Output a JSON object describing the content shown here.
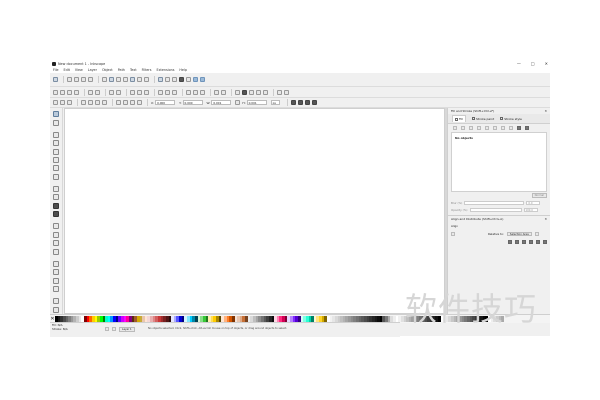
{
  "window": {
    "title": "New document 1 - Inkscape",
    "controls": [
      "—",
      "□",
      "✕"
    ]
  },
  "menu": [
    "File",
    "Edit",
    "View",
    "Layer",
    "Object",
    "Path",
    "Text",
    "Filters",
    "Extensions",
    "Help"
  ],
  "tool_controls": {
    "x_label": "X:",
    "x_value": "0.000",
    "y_label": "Y:",
    "y_value": "0.000",
    "w_label": "W:",
    "w_value": "0.001",
    "h_label": "H:",
    "h_value": "0.001",
    "unit": "px"
  },
  "dock": {
    "fill_panel_title": "Fill and Stroke (Shift+Ctrl+F)",
    "tabs": [
      "Fill",
      "Stroke paint",
      "Stroke style"
    ],
    "objects_text": "No objects",
    "blur_label": "Blur (%)",
    "blur_value": "0.0",
    "opacity_label": "Opacity (%)",
    "opacity_value": "100.0",
    "align_panel_title": "Align and Distribute (Shift+Ctrl+A)",
    "align_label": "Align",
    "relative_label": "Relative to:",
    "relative_value": "Selection Area"
  },
  "statusbar": {
    "fill_label": "Fill:",
    "fill_value": "N/A",
    "stroke_label": "Stroke:",
    "stroke_value": "N/A",
    "layer": "Layer 1",
    "message": "No objects selected. Click, Shift+click, Alt+scroll mouse on top of objects, or drag around objects to select.",
    "x_label": "X:",
    "x_value": "-182.86",
    "y_label": "Y:",
    "y_value": "598.57",
    "zoom_label": "Z:",
    "zoom_value": "35%"
  },
  "colors": {
    "accent": "#9bbad8",
    "palette": [
      "#000000",
      "#1a1a1a",
      "#333333",
      "#4d4d4d",
      "#666666",
      "#808080",
      "#999999",
      "#b3b3b3",
      "#cccccc",
      "#e6e6e6",
      "#ffffff",
      "#800000",
      "#ff0000",
      "#ff6600",
      "#ffcc00",
      "#ffff00",
      "#99cc00",
      "#00ff00",
      "#008000",
      "#00ffcc",
      "#00ffff",
      "#0099ff",
      "#0000ff",
      "#000080",
      "#6600ff",
      "#cc00ff",
      "#ff00ff",
      "#ff0099",
      "#800080",
      "#5a2d0c",
      "#a05a2c",
      "#d4aa00",
      "#c8ab37",
      "#e9c6af",
      "#ffe6d5",
      "#f4d7d7",
      "#e9afaf",
      "#de8787",
      "#d35f5f",
      "#c83737",
      "#a02c2c",
      "#782121",
      "#501616",
      "#280b0b",
      "#e6e6ff",
      "#aaaaff",
      "#5555ff",
      "#0000d4",
      "#000080",
      "#d5f6ff",
      "#80e5ff",
      "#00ccff",
      "#0088aa",
      "#004455",
      "#d7f4d7",
      "#87de87",
      "#37c837",
      "#217821",
      "#ffeeaa",
      "#ffdd55",
      "#ffcc00",
      "#aa8800",
      "#554400",
      "#ffe6d5",
      "#ffb380",
      "#ff7f2a",
      "#d45500",
      "#803300",
      "#f4e3d7",
      "#e9c6af",
      "#deaa87",
      "#c87137",
      "#784421",
      "#ececec",
      "#d9d9d9",
      "#bfbfbf",
      "#a6a6a6",
      "#8c8c8c",
      "#737373",
      "#595959",
      "#404040",
      "#262626",
      "#0d0d0d",
      "#ffd5e5",
      "#ff80b2",
      "#ff2a7f",
      "#d40055",
      "#800033",
      "#e5d5ff",
      "#b380ff",
      "#7f2aff",
      "#5500d4",
      "#330080",
      "#d5fff6",
      "#80ffe6",
      "#2affd5",
      "#00d4aa",
      "#008066",
      "#fff6d5",
      "#ffe680",
      "#ffd42a",
      "#d4aa00",
      "#806600",
      "#ffffff",
      "#f2f2f2",
      "#e6e6e6",
      "#d9d9d9",
      "#cccccc",
      "#bfbfbf",
      "#b3b3b3",
      "#a6a6a6",
      "#999999",
      "#8c8c8c",
      "#808080",
      "#737373",
      "#666666",
      "#595959",
      "#4d4d4d",
      "#404040",
      "#333333",
      "#262626",
      "#1a1a1a",
      "#0d0d0d",
      "#000000",
      "#555555",
      "#777777",
      "#aaaaaa",
      "#dddddd",
      "#eeeeee",
      "#ffffff",
      "#f0f0f0",
      "#e0e0e0",
      "#d0d0d0",
      "#c0c0c0",
      "#b0b0b0",
      "#a0a0a0",
      "#909090",
      "#808080",
      "#707070",
      "#606060",
      "#505050",
      "#404040",
      "#303030",
      "#202020",
      "#101010",
      "#000000",
      "#ffffff",
      "#f8f8f8",
      "#e8e8e8",
      "#d8d8d8",
      "#c8c8c8",
      "#b8b8b8",
      "#a8a8a8",
      "#989898",
      "#888888",
      "#787878",
      "#686868",
      "#585858",
      "#484848",
      "#383838",
      "#282828",
      "#181818",
      "#080808",
      "#000000",
      "#ffffff",
      "#eeeeee",
      "#dddddd",
      "#cccccc",
      "#bbbbbb",
      "#aaaaaa"
    ]
  },
  "watermark": "软件技巧"
}
